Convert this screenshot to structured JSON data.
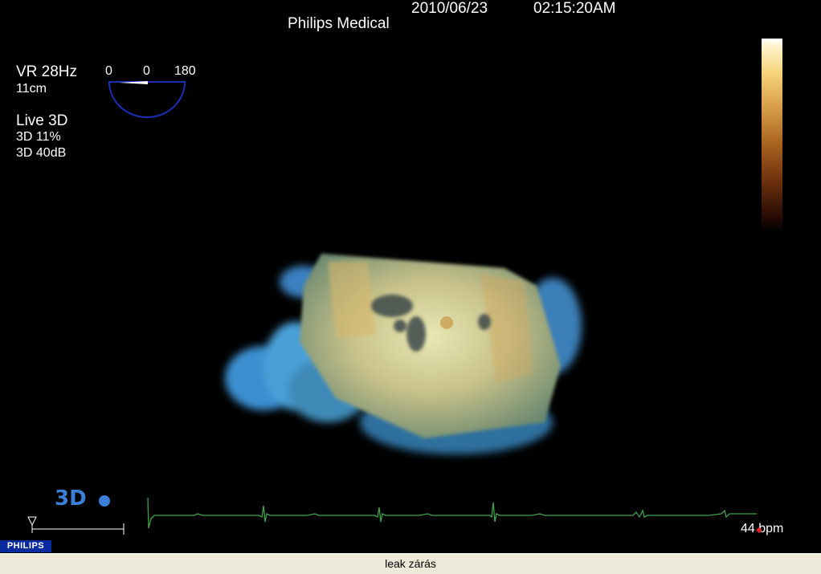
{
  "header": {
    "date": "2010/06/23",
    "time": "02:15:20AM",
    "vendor": "Philips Medical"
  },
  "params": {
    "frame_rate": "VR 28Hz",
    "depth": "11cm",
    "mode": "Live 3D",
    "gain": "3D 11%",
    "dynamic_range": "3D 40dB"
  },
  "probe_angles": [
    "0",
    "0",
    "180"
  ],
  "ecg": {
    "heart_rate": "44 bpm"
  },
  "brand": {
    "label": "PHILIPS",
    "logo": "3D"
  },
  "footer": {
    "caption": "leak zárás"
  },
  "colors": {
    "sector_outline": "#1a2fb5",
    "ecg_trace": "#3fa34a",
    "brand_bg": "#0a2aa0",
    "status_bg": "#ece9d8"
  }
}
